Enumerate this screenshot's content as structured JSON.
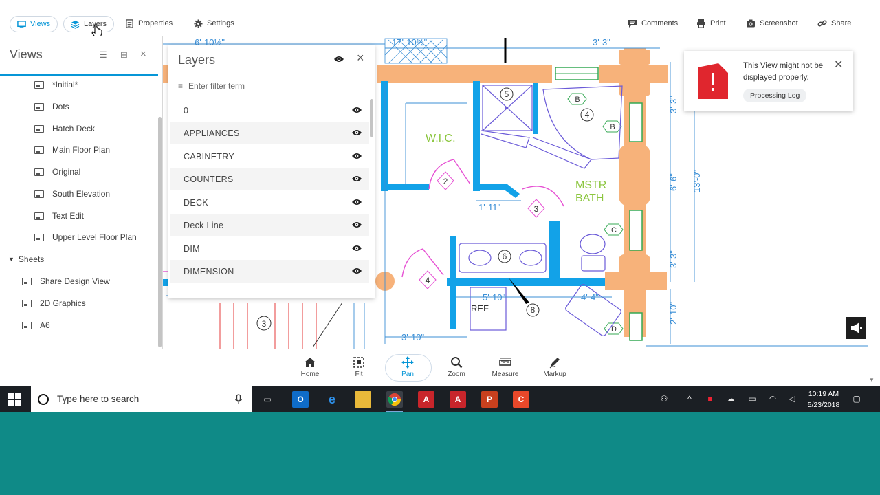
{
  "toolbar": {
    "tabs": [
      {
        "label": "Views",
        "icon": "monitor-icon",
        "active": true
      },
      {
        "label": "Layers",
        "icon": "layers-icon",
        "active": false
      },
      {
        "label": "Properties",
        "icon": "document-icon",
        "active": false
      },
      {
        "label": "Settings",
        "icon": "gear-icon",
        "active": false
      }
    ],
    "right_tools": [
      {
        "label": "Comments",
        "icon": "comment-icon"
      },
      {
        "label": "Print",
        "icon": "printer-icon"
      },
      {
        "label": "Screenshot",
        "icon": "camera-icon"
      },
      {
        "label": "Share",
        "icon": "link-icon"
      }
    ]
  },
  "views_panel": {
    "title": "Views",
    "items": [
      "*Initial*",
      "Dots",
      "Hatch Deck",
      "Main Floor Plan",
      "Original",
      "South Elevation",
      "Text Edit",
      "Upper Level Floor Plan"
    ],
    "sheets_heading": "Sheets",
    "sheets": [
      "Share Design View",
      "2D Graphics",
      "A6"
    ]
  },
  "layers_panel": {
    "title": "Layers",
    "filter_placeholder": "Enter filter term",
    "layers": [
      "0",
      "APPLIANCES",
      "CABINETRY",
      "COUNTERS",
      "DECK",
      "Deck Line",
      "DIM",
      "DIMENSION"
    ]
  },
  "notification": {
    "message": "This View might not be displayed properly.",
    "button": "Processing Log",
    "accent": "#e0262e"
  },
  "bottom_tools": [
    {
      "label": "Home",
      "icon": "home-icon",
      "active": false
    },
    {
      "label": "Fit",
      "icon": "fit-icon",
      "active": false
    },
    {
      "label": "Pan",
      "icon": "pan-icon",
      "active": true
    },
    {
      "label": "Zoom",
      "icon": "zoom-icon",
      "active": false
    },
    {
      "label": "Measure",
      "icon": "ruler-icon",
      "active": false
    },
    {
      "label": "Markup",
      "icon": "pen-icon",
      "active": false
    }
  ],
  "drawing": {
    "labels": [
      "W.I.C.",
      "MSTR",
      "BATH",
      "REF"
    ],
    "dimensions": [
      "6'-10½\"",
      "17'-10½\"",
      "3'-3\"",
      "1'-11\"",
      "5'-10\"",
      "4'-4\"",
      "3'-10\"",
      "3'-3\"",
      "6'-6\"",
      "13'-0\"",
      "3'-3\"",
      "2'-10\""
    ],
    "tags": [
      "5",
      "B",
      "4",
      "B",
      "2",
      "3",
      "C",
      "6",
      "4",
      "8",
      "D",
      "3"
    ]
  },
  "taskbar": {
    "search_placeholder": "Type here to search",
    "time": "10:19 AM",
    "date": "5/23/2018",
    "apps": [
      "task-view-icon",
      "outlook-icon",
      "edge-icon",
      "explorer-icon",
      "chrome-icon",
      "autocad-icon",
      "autocad-lt-icon",
      "powerpoint-icon",
      "snagit-icon"
    ]
  }
}
